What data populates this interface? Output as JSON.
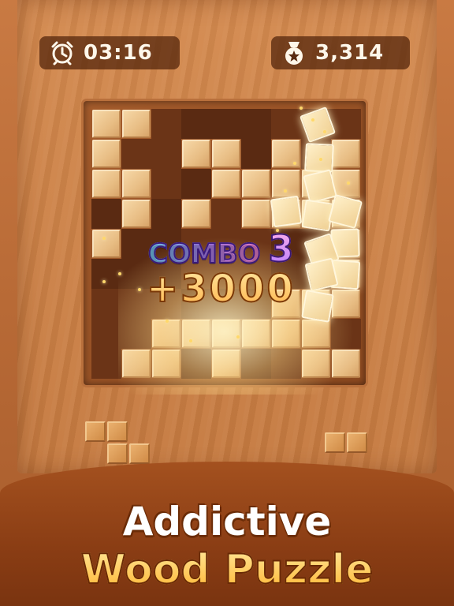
{
  "hud": {
    "timer": {
      "icon": "alarm-clock-icon",
      "value": "03:16"
    },
    "score": {
      "icon": "medal-icon",
      "value": "3,314"
    }
  },
  "board": {
    "rows": 9,
    "cols": 9,
    "filled": [
      [
        1,
        1,
        0,
        0,
        0,
        0,
        0,
        0,
        0
      ],
      [
        1,
        0,
        0,
        1,
        1,
        0,
        1,
        0,
        1
      ],
      [
        1,
        1,
        0,
        0,
        1,
        1,
        1,
        1,
        1
      ],
      [
        0,
        1,
        0,
        1,
        0,
        1,
        1,
        1,
        1
      ],
      [
        1,
        0,
        0,
        0,
        0,
        0,
        0,
        0,
        1
      ],
      [
        0,
        0,
        0,
        0,
        0,
        0,
        0,
        0,
        1
      ],
      [
        0,
        0,
        0,
        0,
        0,
        0,
        1,
        1,
        1
      ],
      [
        0,
        0,
        1,
        1,
        1,
        1,
        1,
        1,
        0
      ],
      [
        0,
        1,
        1,
        0,
        1,
        0,
        0,
        1,
        1
      ]
    ]
  },
  "combo": {
    "label": "COMBO",
    "count": "3",
    "points": "+3000"
  },
  "pieces": [
    {
      "name": "piece-s-shape",
      "cells": [
        [
          0,
          0
        ],
        [
          0,
          1
        ],
        [
          1,
          1
        ],
        [
          1,
          2
        ]
      ]
    },
    {
      "name": "piece-domino",
      "cells": [
        [
          0,
          0
        ],
        [
          0,
          1
        ]
      ]
    }
  ],
  "banner": {
    "line1": "Addictive",
    "line2": "Wood Puzzle"
  },
  "colors": {
    "empty_cell": "#6b3417",
    "filled_cell": "#e8bd84",
    "banner": "#8a3d14",
    "title_gold": "#ffb531"
  }
}
